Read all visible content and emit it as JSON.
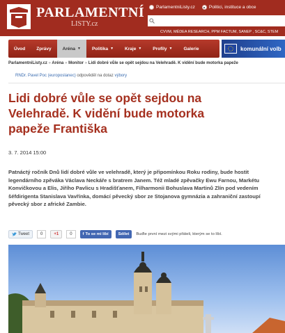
{
  "site": {
    "logo_main": "PARLAMENTNÍ",
    "logo_sub": "LISTY.cz",
    "search_scope": [
      {
        "label": "ParlamentniListy.cz",
        "selected": false
      },
      {
        "label": "Politici, instituce a obce",
        "selected": true
      }
    ],
    "partners": "CVVM, MÉDEA RESEARCH, PPM FACTUM, SANEP , SC&C, STEM",
    "accent_color": "#a12c1f"
  },
  "nav": {
    "items": [
      {
        "label": "Úvod",
        "dropdown": false,
        "active": false
      },
      {
        "label": "Zprávy",
        "dropdown": false,
        "active": false
      },
      {
        "label": "Aréna",
        "dropdown": true,
        "active": true
      },
      {
        "label": "Politika",
        "dropdown": true,
        "active": false
      },
      {
        "label": "Kraje",
        "dropdown": true,
        "active": false
      },
      {
        "label": "Profily",
        "dropdown": true,
        "active": false
      },
      {
        "label": "Galerie",
        "dropdown": false,
        "active": false
      }
    ],
    "banner": "komunální volb"
  },
  "breadcrumb": {
    "items": [
      "ParlamentniListy.cz",
      "Aréna",
      "Monitor",
      "Lidi dobré vůle se opět sejdou na Velehradě. K vidění bude motorka papeže"
    ],
    "separator": "»"
  },
  "qa": {
    "person": "RNDr. Pavel Poc (europoslanec)",
    "text": "odpověděl na dotaz",
    "link": "výbory"
  },
  "article": {
    "title": "Lidi dobré vůle se opět sejdou na Velehradě. K vidění bude motorka papeže Františka",
    "date": "3. 7. 2014 15:00",
    "lead": "Patnáctý ročník Dnů lidí dobré vůle ve velehradě, který je připomínkou Roku rodiny, bude hostit legendárního zpěváka Václava Neckáře s bratrem Janem. Též mladé zpěvačky Ewu Farnou, Markétu Konvičkovou a Elis, Jiřího Pavlicu s Hradišťanem, Filharmonii Bohuslava Martinů Zlín pod vedením šéfdirigenta Stanislava Vavřínka, domácí pěvecký sbor ze Stojanova gymnázia a zahraniční zastoupí pěvecký sbor z africké Zambie."
  },
  "social": {
    "tweet_label": "Tweet",
    "tweet_count": "0",
    "gplus_label": "+1",
    "gplus_count": "0",
    "fb_like": "To se mi líbí",
    "fb_share": "Sdílet",
    "fb_text": "Buďte první mezi svými přáteli, kterým se to líbí."
  }
}
